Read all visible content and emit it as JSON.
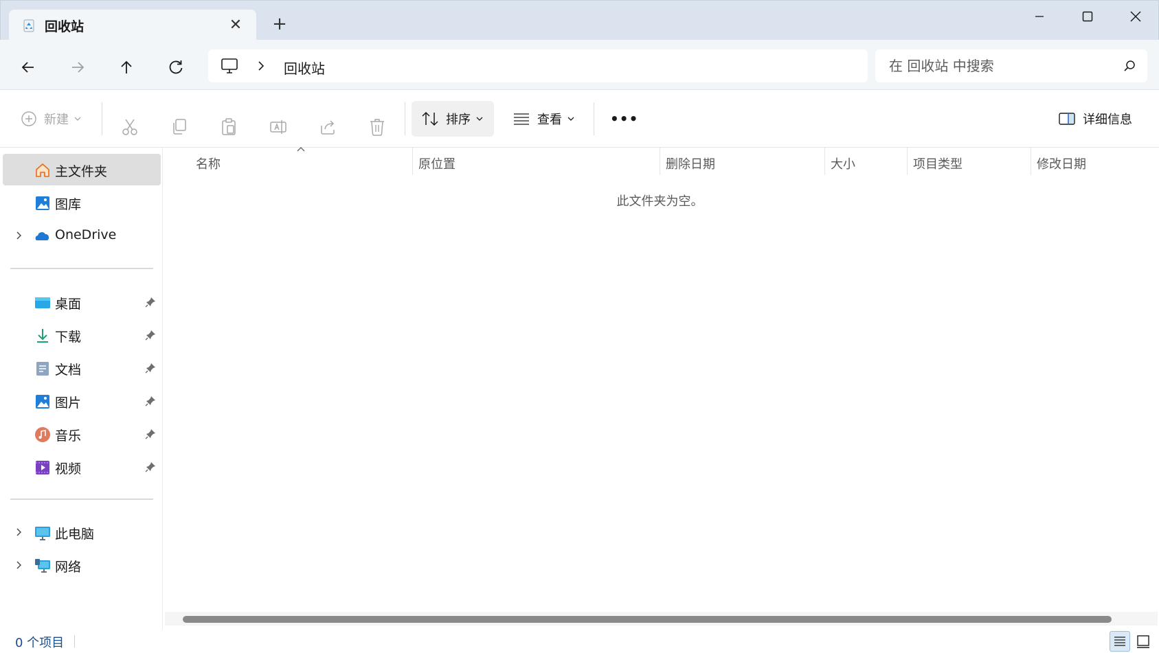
{
  "window": {
    "tab_title": "回收站",
    "tab_close_icon": "close-icon",
    "new_tab_icon": "plus-icon",
    "controls": [
      "minimize-icon",
      "maximize-icon",
      "close-icon"
    ]
  },
  "navigation": {
    "buttons": [
      "back-arrow-icon",
      "forward-arrow-icon",
      "up-arrow-icon",
      "refresh-icon"
    ],
    "address": {
      "location": "回收站"
    },
    "search": {
      "placeholder": "在 回收站 中搜索",
      "value": ""
    }
  },
  "toolbar": {
    "new_label": "新建",
    "sort_label": "排序",
    "view_label": "查看",
    "more_label": "•••",
    "details_label": "详细信息",
    "disabled_icons": [
      "cut-icon",
      "copy-icon",
      "paste-icon",
      "rename-icon",
      "share-icon",
      "delete-icon"
    ]
  },
  "sidebar": {
    "quick": [
      {
        "label": "主文件夹",
        "icon": "home-icon",
        "selected": true
      },
      {
        "label": "图库",
        "icon": "gallery-icon"
      },
      {
        "label": "OneDrive",
        "icon": "onedrive-icon",
        "expandable": true
      }
    ],
    "pinned": [
      {
        "label": "桌面",
        "icon": "desktop-icon"
      },
      {
        "label": "下载",
        "icon": "download-icon"
      },
      {
        "label": "文档",
        "icon": "documents-icon"
      },
      {
        "label": "图片",
        "icon": "pictures-icon"
      },
      {
        "label": "音乐",
        "icon": "music-icon"
      },
      {
        "label": "视频",
        "icon": "videos-icon"
      }
    ],
    "devices": [
      {
        "label": "此电脑",
        "icon": "this-pc-icon",
        "expandable": true
      },
      {
        "label": "网络",
        "icon": "network-icon",
        "expandable": true
      }
    ]
  },
  "file_list": {
    "columns": [
      "名称",
      "原位置",
      "删除日期",
      "大小",
      "项目类型",
      "修改日期"
    ],
    "sorted_column": "名称",
    "empty_message": "此文件夹为空。"
  },
  "status": {
    "item_count": "0 个项目",
    "active_view": "details"
  }
}
